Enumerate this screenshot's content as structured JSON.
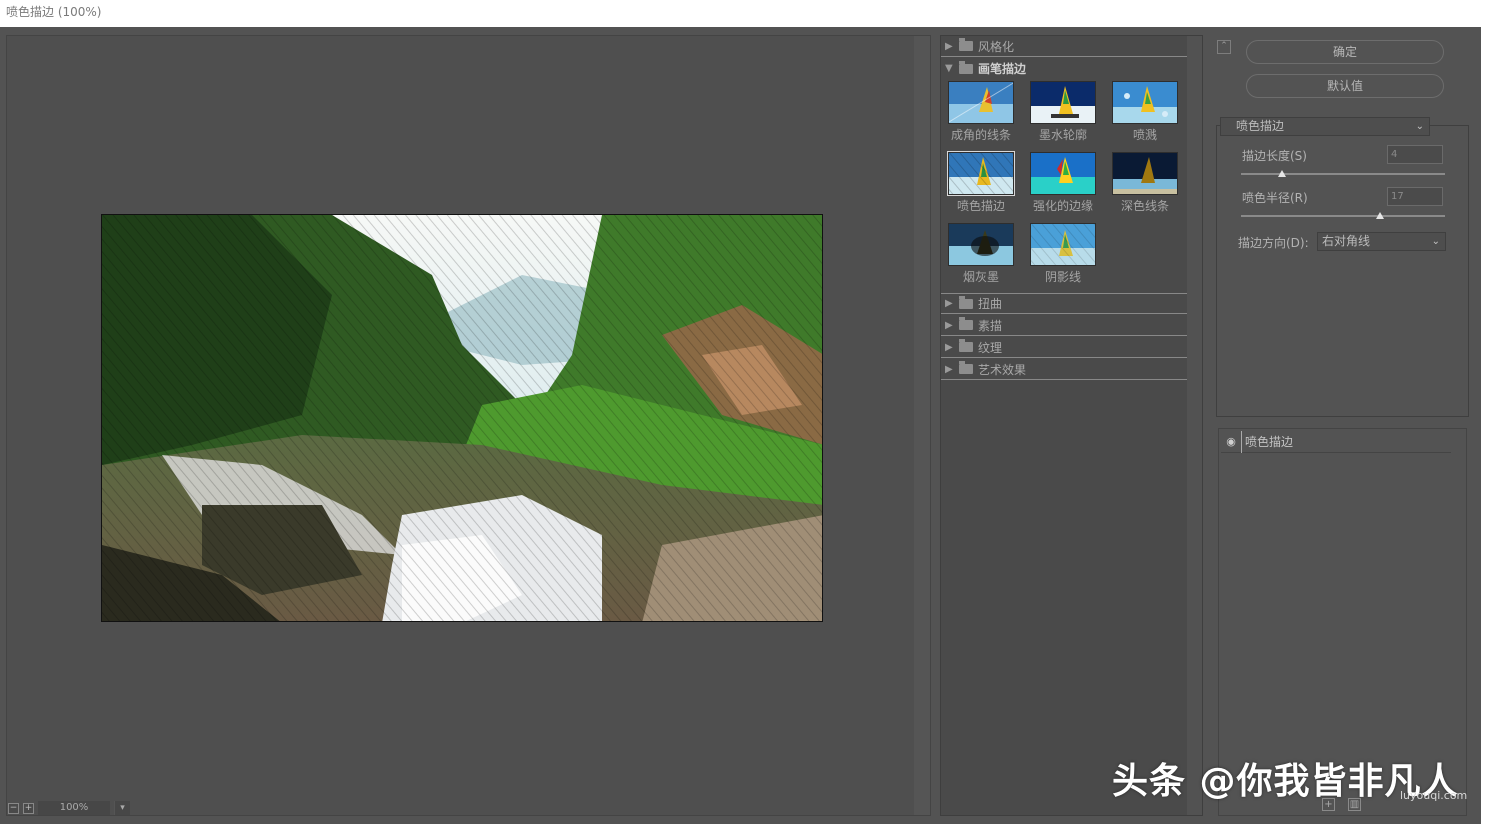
{
  "window": {
    "title": "喷色描边 (100%)"
  },
  "preview": {
    "zoom": "100%"
  },
  "gallery": {
    "categories_top": [
      {
        "label": "风格化",
        "open": false
      },
      {
        "label": "画笔描边",
        "open": true
      }
    ],
    "thumbnails": [
      {
        "label": "成角的线条"
      },
      {
        "label": "墨水轮廓"
      },
      {
        "label": "喷溅"
      },
      {
        "label": "喷色描边"
      },
      {
        "label": "强化的边缘"
      },
      {
        "label": "深色线条"
      },
      {
        "label": "烟灰墨"
      },
      {
        "label": "阴影线"
      }
    ],
    "categories_bottom": [
      {
        "label": "扭曲"
      },
      {
        "label": "素描"
      },
      {
        "label": "纹理"
      },
      {
        "label": "艺术效果"
      }
    ]
  },
  "options": {
    "ok_label": "确定",
    "default_label": "默认值",
    "filter_select": "喷色描边",
    "stroke_length_label": "描边长度(S)",
    "stroke_length_value": "4",
    "stroke_length_fraction": 0.2,
    "spray_radius_label": "喷色半径(R)",
    "spray_radius_value": "17",
    "spray_radius_fraction": 0.68,
    "direction_label": "描边方向(D):",
    "direction_value": "右对角线"
  },
  "layers": {
    "items": [
      {
        "name": "喷色描边"
      }
    ]
  },
  "watermark": {
    "text": "头条 @你我皆非凡人",
    "site": "luyouqi.com"
  },
  "icons": {
    "collapse": "collapse-icon",
    "eye": "eye-icon",
    "folder": "folder-icon"
  },
  "colors": {
    "background": "#535353",
    "panel": "#4a4a4a",
    "titlebar": "#ffffff"
  }
}
